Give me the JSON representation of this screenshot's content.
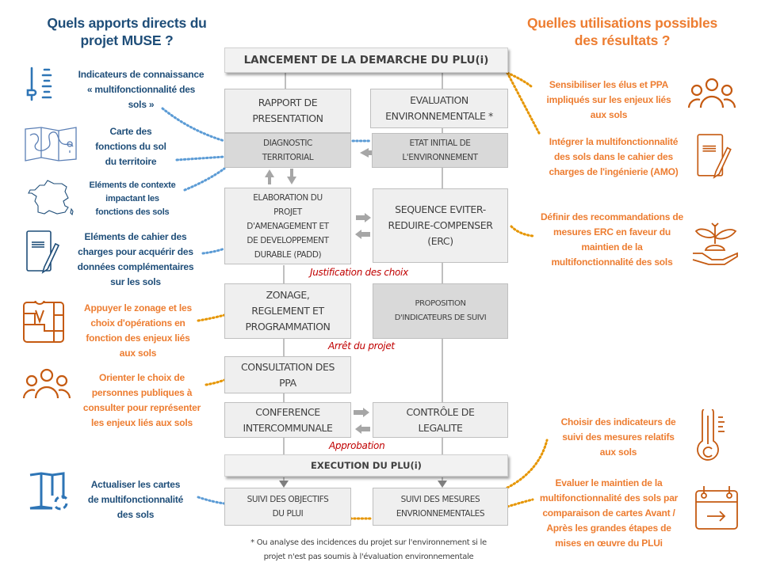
{
  "left_column": {
    "heading": [
      "Quels apports directs du",
      "projet MUSE ?"
    ],
    "items": [
      {
        "icon": "slider-gauge-icon",
        "lines": [
          "Indicateurs de connaissance",
          "« multifonctionnalité des",
          "sols »"
        ]
      },
      {
        "icon": "map-pin-icon",
        "lines": [
          "Carte des",
          "fonctions du sol",
          "du territoire"
        ]
      },
      {
        "icon": "france-map-icon",
        "lines": [
          "Eléments de contexte",
          "impactant les",
          "fonctions des sols"
        ]
      },
      {
        "icon": "document-pencil-icon",
        "lines": [
          "Eléments de cahier des",
          "charges pour acquérir des",
          "données complémentaires",
          "sur les sols"
        ]
      },
      {
        "icon": "zoning-plan-pin-icon",
        "lines": [
          "Appuyer le zonage et les",
          "choix d'opérations en",
          "fonction des enjeux liés",
          "aux sols"
        ]
      },
      {
        "icon": "people-group-icon",
        "lines": [
          "Orienter le choix de",
          "personnes publiques à",
          "consulter pour représenter",
          "les enjeux liés aux sols"
        ]
      },
      {
        "icon": "map-refresh-icon",
        "lines": [
          "Actualiser les cartes",
          "de multifonctionnalité",
          "des sols"
        ]
      }
    ]
  },
  "right_column": {
    "heading": [
      "Quelles utilisations possibles",
      "des résultats ?"
    ],
    "items": [
      {
        "icon": "people-group-icon",
        "lines": [
          "Sensibiliser les élus et PPA",
          "impliqués sur les enjeux liés",
          "aux sols"
        ]
      },
      {
        "icon": "document-pencil-icon",
        "lines": [
          "Intégrer la multifonctionnalité",
          "des sols dans le cahier des",
          "charges de l'ingénierie (AMO)"
        ]
      },
      {
        "icon": "hand-plant-icon",
        "lines": [
          "Définir des recommandations de",
          "mesures ERC en faveur du",
          "maintien de la",
          "multifonctionnalité des sols"
        ]
      },
      {
        "icon": "thermometer-icon",
        "lines": [
          "Choisir des indicateurs de",
          "suivi des mesures relatifs",
          "aux sols"
        ]
      },
      {
        "icon": "calendar-arrow-icon",
        "lines": [
          "Evaluer le maintien de la",
          "multifonctionnalité des sols par",
          "comparaison de cartes Avant /",
          "Après les grandes étapes de",
          "mises en œuvre du PLUi"
        ]
      }
    ]
  },
  "flow": {
    "launch": "LANCEMENT DE LA DEMARCHE DU PLU(i)",
    "rapport": [
      "RAPPORT DE",
      "PRESENTATION"
    ],
    "diagnostic": [
      "DIAGNOSTIC",
      "TERRITORIAL"
    ],
    "evaluation": [
      "EVALUATION",
      "ENVIRONNEMENTALE *"
    ],
    "etat_initial": [
      "ETAT INITIAL DE",
      "L'ENVIRONNEMENT"
    ],
    "padd": [
      "ELABORATION DU",
      "PROJET",
      "D'AMENAGEMENT ET",
      "DE DEVELOPPEMENT",
      "DURABLE (PADD)"
    ],
    "erc": [
      "SEQUENCE EVITER-",
      "REDUIRE-COMPENSER",
      "(ERC)"
    ],
    "justification": "Justification des choix",
    "zonage": [
      "ZONAGE,",
      "REGLEMENT ET",
      "PROGRAMMATION"
    ],
    "indicateurs": [
      "PROPOSITION",
      "D'INDICATEURS  DE SUIVI"
    ],
    "arret": "Arrêt du projet",
    "consultation": [
      "CONSULTATION DES",
      "PPA"
    ],
    "conference": [
      "CONFERENCE",
      "INTERCOMMUNALE"
    ],
    "controle": [
      "CONTRÔLE DE",
      "LEGALITE"
    ],
    "approbation": "Approbation",
    "execution": "EXECUTION DU PLU(i)",
    "suivi_objectifs": [
      "SUIVI DES OBJECTIFS",
      "DU PLUI"
    ],
    "suivi_mesures": [
      "SUIVI DES MESURES",
      "ENVRIONNEMENTALES"
    ],
    "footnote": [
      "* Ou analyse des incidences du projet sur l'environnement  si le",
      "projet n'est pas soumis à l'évaluation  environnementale"
    ]
  },
  "colors": {
    "blue": "#1f4e79",
    "blue_icon": "#2e75b6",
    "blue_dots": "#5b9bd5",
    "orange": "#ed7d31",
    "orange_icon": "#c55a11",
    "orange_dots": "#e69500",
    "red_label": "#c00000",
    "box_light": "#efefef",
    "box_dark": "#d9d9d9",
    "text_dark": "#404040",
    "arrow_gray": "#a6a6a6"
  }
}
